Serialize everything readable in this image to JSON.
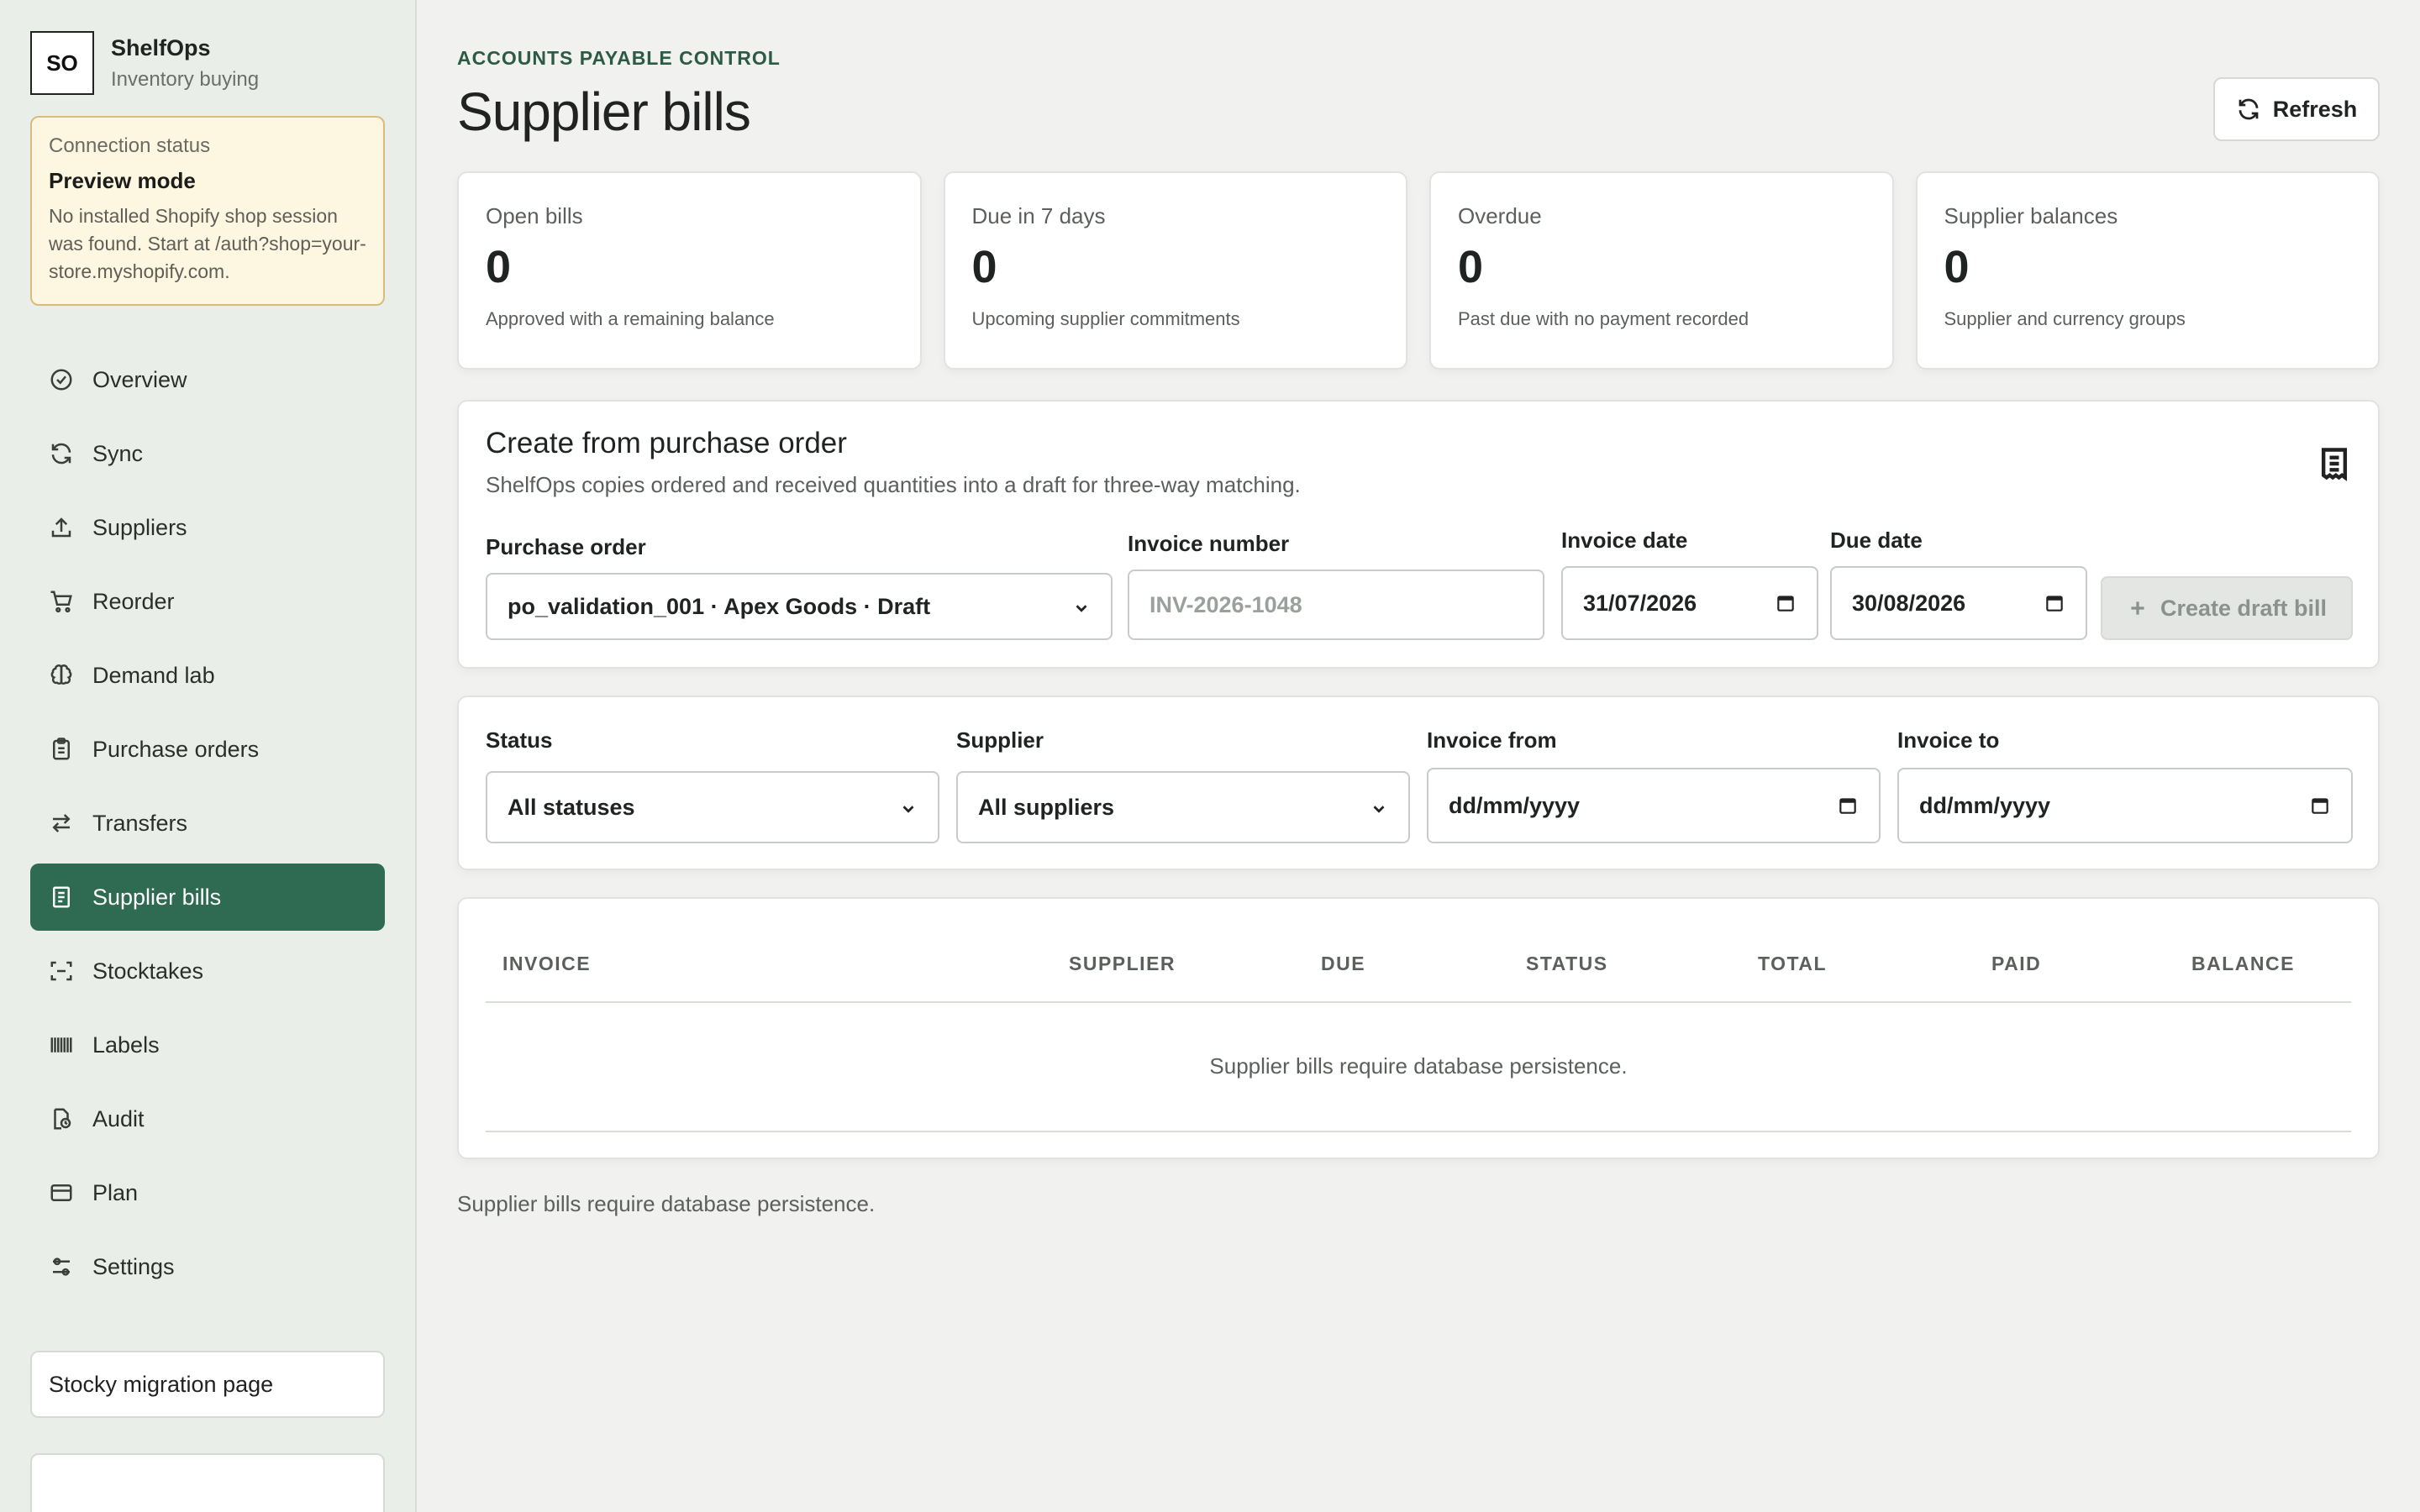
{
  "brand": {
    "initials": "SO",
    "name": "ShelfOps",
    "subtitle": "Inventory buying"
  },
  "connection": {
    "label": "Connection status",
    "title": "Preview mode",
    "message": "No installed Shopify shop session was found. Start at /auth?shop=your-store.myshopify.com."
  },
  "nav": [
    {
      "label": "Overview",
      "icon": "check-circle-icon"
    },
    {
      "label": "Sync",
      "icon": "sync-icon"
    },
    {
      "label": "Suppliers",
      "icon": "upload-icon"
    },
    {
      "label": "Reorder",
      "icon": "cart-icon"
    },
    {
      "label": "Demand lab",
      "icon": "brain-icon"
    },
    {
      "label": "Purchase orders",
      "icon": "clipboard-icon"
    },
    {
      "label": "Transfers",
      "icon": "transfer-icon"
    },
    {
      "label": "Supplier bills",
      "icon": "bill-icon",
      "active": true
    },
    {
      "label": "Stocktakes",
      "icon": "scan-icon"
    },
    {
      "label": "Labels",
      "icon": "barcode-icon"
    },
    {
      "label": "Audit",
      "icon": "audit-icon"
    },
    {
      "label": "Plan",
      "icon": "card-icon"
    },
    {
      "label": "Settings",
      "icon": "sliders-icon"
    }
  ],
  "sidebar_button": "Stocky migration page",
  "header": {
    "eyebrow": "ACCOUNTS PAYABLE CONTROL",
    "title": "Supplier bills",
    "refresh_label": "Refresh"
  },
  "stats": [
    {
      "label": "Open bills",
      "value": "0",
      "sub": "Approved with a remaining balance"
    },
    {
      "label": "Due in 7 days",
      "value": "0",
      "sub": "Upcoming supplier commitments"
    },
    {
      "label": "Overdue",
      "value": "0",
      "sub": "Past due with no payment recorded"
    },
    {
      "label": "Supplier balances",
      "value": "0",
      "sub": "Supplier and currency groups"
    }
  ],
  "create": {
    "title": "Create from purchase order",
    "description": "ShelfOps copies ordered and received quantities into a draft for three-way matching.",
    "po_label": "Purchase order",
    "po_value": "po_validation_001 · Apex Goods · Draft",
    "invoice_label": "Invoice number",
    "invoice_placeholder": "INV-2026-1048",
    "invoice_date_label": "Invoice date",
    "invoice_date_value": "31/07/2026",
    "due_date_label": "Due date",
    "due_date_value": "30/08/2026",
    "create_button": "Create draft bill"
  },
  "filters": {
    "status_label": "Status",
    "status_value": "All statuses",
    "supplier_label": "Supplier",
    "supplier_value": "All suppliers",
    "from_label": "Invoice from",
    "from_value": "dd/mm/yyyy",
    "to_label": "Invoice to",
    "to_value": "dd/mm/yyyy"
  },
  "table": {
    "columns": [
      "INVOICE",
      "SUPPLIER",
      "DUE",
      "STATUS",
      "TOTAL",
      "PAID",
      "BALANCE"
    ],
    "empty_message": "Supplier bills require database persistence."
  },
  "footer_message": "Supplier bills require database persistence."
}
